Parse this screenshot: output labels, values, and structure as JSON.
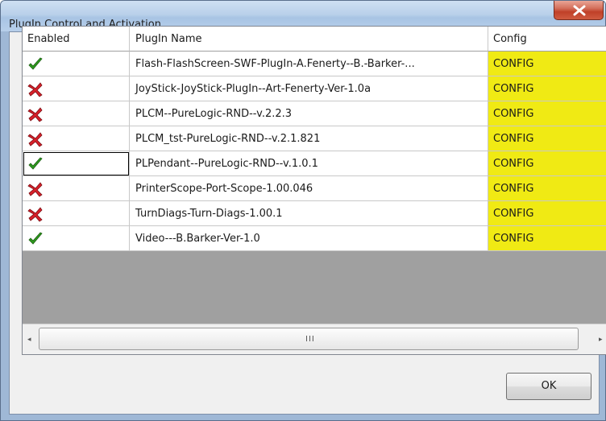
{
  "window": {
    "title": "PlugIn Control and Activation",
    "close_icon": "close-x-icon"
  },
  "table": {
    "columns": {
      "enabled": "Enabled",
      "name": "PlugIn Name",
      "config": "Config"
    },
    "rows": [
      {
        "enabled": true,
        "name": "Flash-FlashScreen-SWF-PlugIn-A.Fenerty--B.-Barker-...",
        "config": "CONFIG"
      },
      {
        "enabled": false,
        "name": "JoyStick-JoyStick-PlugIn--Art-Fenerty-Ver-1.0a",
        "config": "CONFIG"
      },
      {
        "enabled": false,
        "name": "PLCM--PureLogic-RND--v.2.2.3",
        "config": "CONFIG"
      },
      {
        "enabled": false,
        "name": "PLCM_tst-PureLogic-RND--v.2.1.821",
        "config": "CONFIG"
      },
      {
        "enabled": true,
        "name": "PLPendant--PureLogic-RND--v.1.0.1",
        "config": "CONFIG"
      },
      {
        "enabled": false,
        "name": "PrinterScope-Port-Scope-1.00.046",
        "config": "CONFIG"
      },
      {
        "enabled": false,
        "name": "TurnDiags-Turn-Diags-1.00.1",
        "config": "CONFIG"
      },
      {
        "enabled": true,
        "name": "Video---B.Barker-Ver-1.0",
        "config": "CONFIG"
      }
    ],
    "selected_row": 4,
    "enabled_icon": "green-check-icon",
    "disabled_icon": "red-x-icon",
    "config_color": "#f0ea14"
  },
  "scrollbar": {
    "left_arrow": "◂",
    "right_arrow": "▸",
    "grip": "III"
  },
  "buttons": {
    "ok_label": "OK"
  }
}
